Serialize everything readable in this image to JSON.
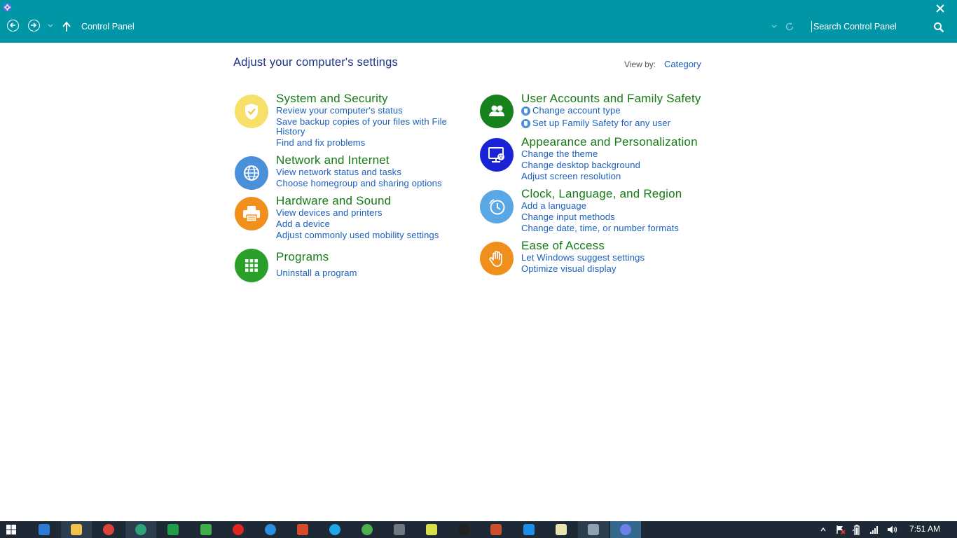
{
  "window": {
    "breadcrumb": "Control Panel",
    "search_placeholder": "Search Control Panel",
    "accent": "#0096a6"
  },
  "main": {
    "title": "Adjust your computer's settings",
    "view_by_label": "View by:",
    "view_by_value": "Category"
  },
  "categories": [
    {
      "title": "System and Security",
      "icon": "shield-check-icon",
      "color": "#f6e06a",
      "links": [
        "Review your computer's status",
        "Save backup copies of your files with File",
        "History",
        "Find and fix problems"
      ]
    },
    {
      "title": "Network and Internet",
      "icon": "globe-icon",
      "color": "#4a8fd9",
      "links": [
        "View network status and tasks",
        "Choose homegroup and sharing options"
      ]
    },
    {
      "title": "Hardware and Sound",
      "icon": "printer-icon",
      "color": "#f08f1c",
      "links": [
        "View devices and printers",
        "Add a device",
        "Adjust commonly used mobility settings"
      ]
    },
    {
      "title": "Programs",
      "icon": "program-grid-icon",
      "color": "#2aa02a",
      "links": [
        "Uninstall a program"
      ]
    },
    {
      "title": "User Accounts and Family Safety",
      "icon": "users-icon",
      "color": "#17821c",
      "links": [
        "Change account type",
        "Set up Family Safety for any user"
      ]
    },
    {
      "title": "Appearance and Personalization",
      "icon": "monitor-palette-icon",
      "color": "#1a23d6",
      "links": [
        "Change the theme",
        "Change desktop background",
        "Adjust screen resolution"
      ]
    },
    {
      "title": "Clock, Language, and Region",
      "icon": "clock-icon",
      "color": "#5aa7e6",
      "links": [
        "Add a language",
        "Change input methods",
        "Change date, time, or number formats"
      ]
    },
    {
      "title": "Ease of Access",
      "icon": "hand-icon",
      "color": "#f08f1c",
      "links": [
        "Let Windows suggest settings",
        "Optimize visual display"
      ]
    }
  ],
  "taskbar": {
    "apps": [
      {
        "name": "internet-explorer-icon",
        "color": "#2e7bd6"
      },
      {
        "name": "file-explorer-icon",
        "color": "#f2c14e"
      },
      {
        "name": "chrome-icon",
        "color": "#db4437"
      },
      {
        "name": "app-icon-green-circle",
        "color": "#2fa37a"
      },
      {
        "name": "excel-icon",
        "color": "#1f9e47"
      },
      {
        "name": "app-icon-colorful",
        "color": "#3fae49"
      },
      {
        "name": "opera-icon",
        "color": "#e02424"
      },
      {
        "name": "download-manager-icon",
        "color": "#2d8fe0"
      },
      {
        "name": "powerpoint-icon",
        "color": "#d54a2a"
      },
      {
        "name": "skype-icon",
        "color": "#1fa7e8"
      },
      {
        "name": "app-icon-multicolor",
        "color": "#4caf50"
      },
      {
        "name": "gamepad-icon",
        "color": "#707880"
      },
      {
        "name": "sd-card-icon",
        "color": "#d7de4a"
      },
      {
        "name": "command-prompt-icon",
        "color": "#222222"
      },
      {
        "name": "app-icon-tiles",
        "color": "#c94f2e"
      },
      {
        "name": "media-player-icon",
        "color": "#1e8fe6"
      },
      {
        "name": "notepad-icon",
        "color": "#e9e3b0"
      },
      {
        "name": "paint-icon",
        "color": "#8da2b3"
      },
      {
        "name": "control-panel-icon",
        "color": "#6c80e8"
      }
    ],
    "time": "7:51 AM"
  }
}
